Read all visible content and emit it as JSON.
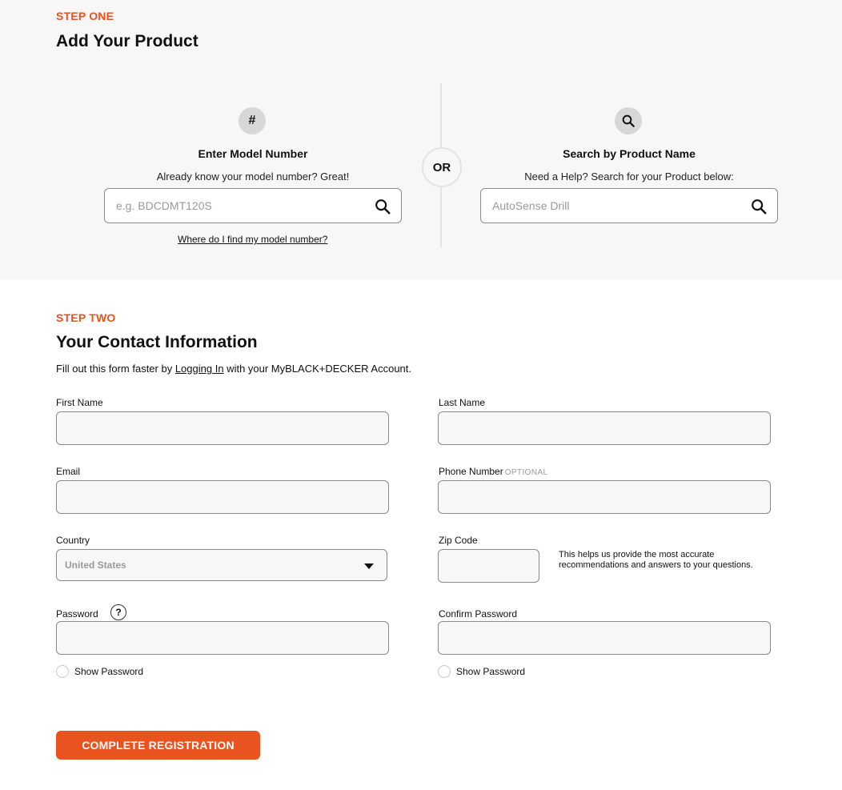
{
  "step_one": {
    "step_label": "STEP ONE",
    "title": "Add Your Product",
    "model": {
      "icon_text": "#",
      "title": "Enter Model Number",
      "subtitle": "Already know your model number? Great!",
      "placeholder": "e.g. BDCDMT120S",
      "help_link": "Where do I find my model number?"
    },
    "or_label": "OR",
    "product": {
      "icon": "search-icon",
      "title": "Search by Product Name",
      "subtitle": "Need a Help? Search for your Product below:",
      "placeholder": "AutoSense Drill"
    }
  },
  "step_two": {
    "step_label": "STEP TWO",
    "title": "Your Contact Information",
    "intro_before": "Fill out this form faster by ",
    "intro_link": "Logging In",
    "intro_after": " with your MyBLACK+DECKER Account.",
    "fields": {
      "first_name": {
        "label": "First Name",
        "value": ""
      },
      "last_name": {
        "label": "Last Name",
        "value": ""
      },
      "email": {
        "label": "Email",
        "value": ""
      },
      "phone": {
        "label": "Phone Number",
        "optional": "OPTIONAL",
        "value": ""
      },
      "country": {
        "label": "Country",
        "value": "United States"
      },
      "zip": {
        "label": "Zip Code",
        "value": ""
      },
      "zip_help": "This helps us provide the most accurate recommendations and answers to your questions.",
      "password": {
        "label": "Password",
        "help_icon": "?",
        "value": ""
      },
      "confirm_password": {
        "label": "Confirm Password",
        "value": ""
      },
      "show_password": "Show Password",
      "show_password_confirm": "Show Password"
    },
    "submit_label": "COMPLETE REGISTRATION"
  },
  "colors": {
    "accent": "#e8531f",
    "panel_bg": "#f7f7f7",
    "field_border": "#8a8a8a"
  }
}
